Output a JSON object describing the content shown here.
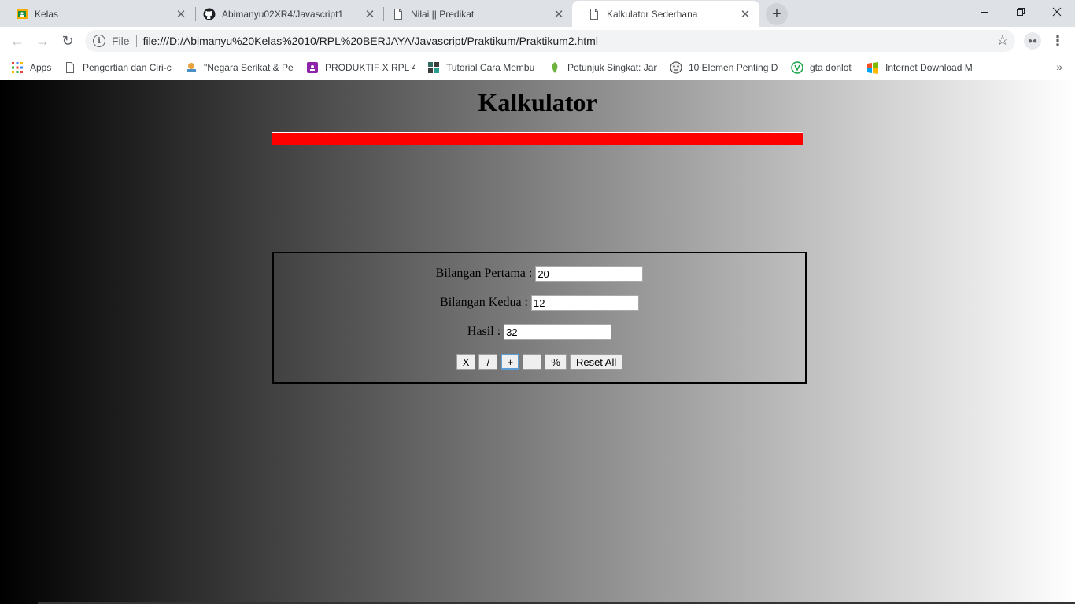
{
  "browser": {
    "tabs": [
      {
        "title": "Kelas",
        "icon": "google-classroom-icon"
      },
      {
        "title": "Abimanyu02XR4/Javascript1",
        "icon": "github-icon"
      },
      {
        "title": "Nilai || Predikat",
        "icon": "page-icon"
      },
      {
        "title": "Kalkulator Sederhana",
        "icon": "page-icon",
        "active": true
      }
    ],
    "address": {
      "scheme": "File",
      "url": "file:///D:/Abimanyu%20Kelas%2010/RPL%20BERJAYA/Javascript/Praktikum/Praktikum2.html"
    },
    "bookmarks": [
      {
        "label": "Apps",
        "icon": "apps-grid-icon"
      },
      {
        "label": "Pengertian dan Ciri-c",
        "icon": "page-icon"
      },
      {
        "label": "\"Negara Serikat & Pe",
        "icon": "globe-icon"
      },
      {
        "label": "PRODUKTIF X RPL 4 -",
        "icon": "classroom-icon"
      },
      {
        "label": "Tutorial Cara Membu",
        "icon": "tutorial-icon"
      },
      {
        "label": "Petunjuk Singkat: Jan",
        "icon": "leaf-icon"
      },
      {
        "label": "10 Elemen Penting D",
        "icon": "emoji-icon"
      },
      {
        "label": "gta donlot",
        "icon": "vuz-icon"
      },
      {
        "label": "Internet Download M",
        "icon": "windows-icon"
      }
    ]
  },
  "page": {
    "title": "Kalkulator",
    "fields": {
      "first_label": "Bilangan Pertama :",
      "first_value": "20",
      "second_label": "Bilangan Kedua :",
      "second_value": "12",
      "result_label": "Hasil :",
      "result_value": "32"
    },
    "buttons": {
      "multiply": "X",
      "divide": "/",
      "add": "+",
      "subtract": "-",
      "modulo": "%",
      "reset": "Reset All"
    },
    "colors": {
      "bar": "#ff0000",
      "gradient_start": "#000000",
      "gradient_end": "#ffffff"
    }
  }
}
